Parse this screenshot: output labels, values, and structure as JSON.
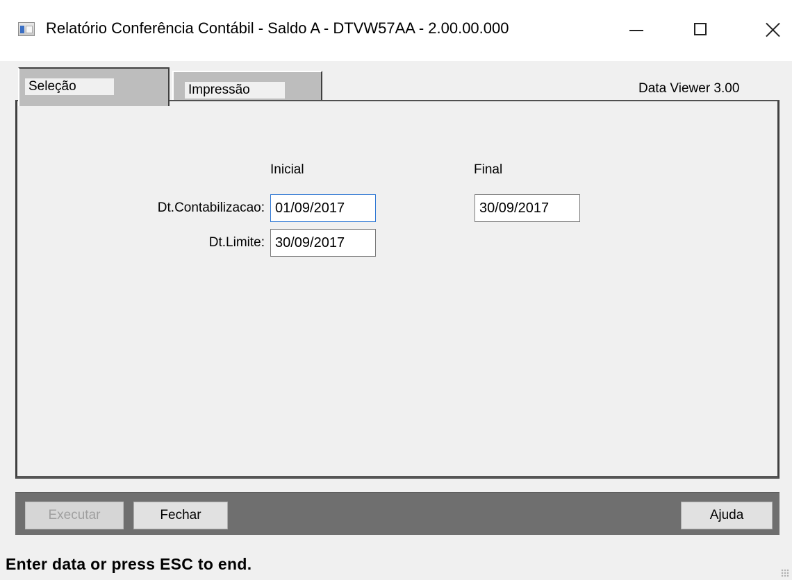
{
  "window": {
    "title": "Relatório Conferência Contábil - Saldo A - DTVW57AA - 2.00.00.000"
  },
  "tabs": [
    {
      "label": "Seleção",
      "selected": true
    },
    {
      "label": "Impressão",
      "selected": false
    }
  ],
  "viewer_label": "Data Viewer 3.00",
  "form": {
    "col_inicial": "Inicial",
    "col_final": "Final",
    "contabilizacao": {
      "label": "Dt.Contabilizacao:",
      "inicial": "01/09/2017",
      "final": "30/09/2017"
    },
    "limite": {
      "label": "Dt.Limite:",
      "inicial": "30/09/2017"
    }
  },
  "buttons": {
    "executar": "Executar",
    "fechar": "Fechar",
    "ajuda": "Ajuda"
  },
  "status": "Enter data or press ESC to end.",
  "colors": {
    "tab_bg": "#bdbdbd",
    "toolbar_bg": "#6f6f6f",
    "focus_border": "#2f78d4"
  }
}
